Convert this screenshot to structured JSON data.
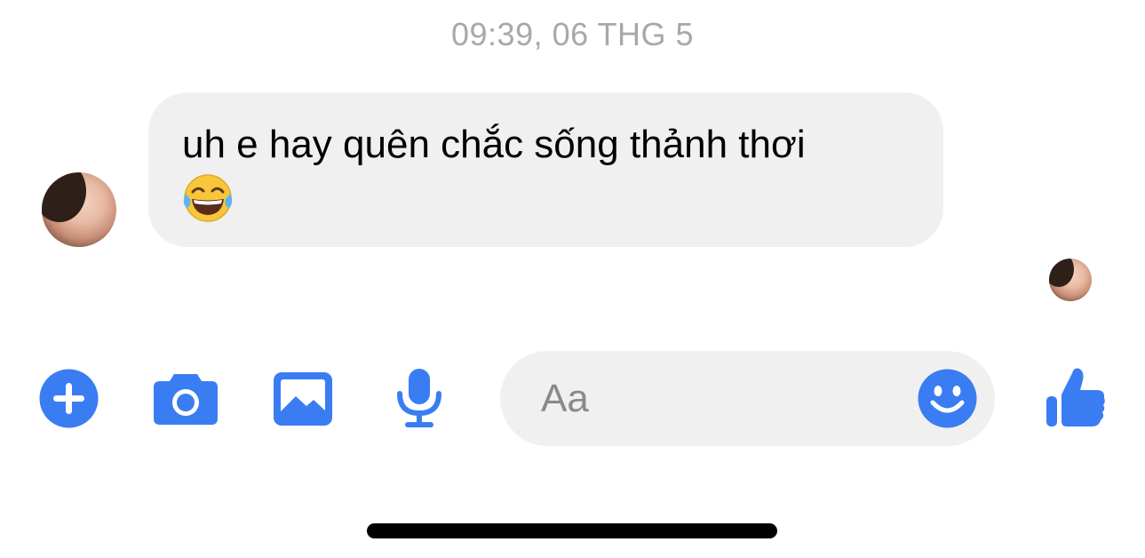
{
  "thread": {
    "timestamp": "09:39, 06 THG 5"
  },
  "message": {
    "text": "uh e hay quên chắc sống thảnh thơi",
    "emoji": "face-with-tears-of-joy"
  },
  "composer": {
    "placeholder": "Aa"
  },
  "toolbar": {
    "icons": [
      "plus-icon",
      "camera-icon",
      "image-icon",
      "microphone-icon",
      "smiley-icon",
      "thumbs-up-icon"
    ]
  },
  "colors": {
    "accent": "#3a7df2",
    "bubble": "#f0f0f0",
    "timestamp": "#a8a8a8",
    "placeholder": "#8a8a8a"
  }
}
